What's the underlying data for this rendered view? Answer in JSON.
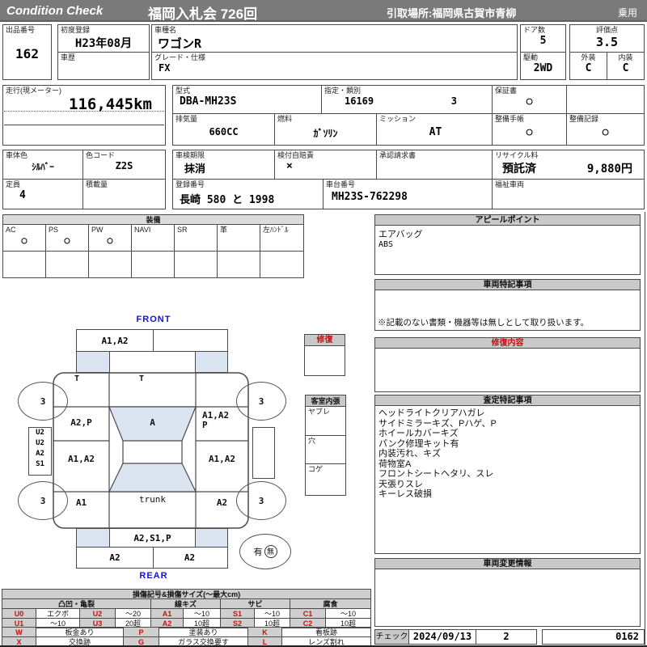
{
  "header": {
    "brand": "Condition  Check",
    "auction": "福岡入札会  726回",
    "pickup": "引取場所:福岡県古賀市青柳",
    "category": "乗用"
  },
  "row1": {
    "lot_label": "出品番号",
    "lot_no": "162",
    "first_reg_label": "初度登録",
    "first_reg": "H23年08月",
    "history_label": "車歴",
    "name_label": "車種名",
    "name": "ワゴンR",
    "grade_label": "グレード・仕様",
    "grade": "FX",
    "doors_label": "ドア数",
    "doors": "5",
    "drive_label": "駆動",
    "drive": "2WD",
    "score_label": "評価点",
    "score": "3.5",
    "ext_label": "外装",
    "ext": "C",
    "int_label": "内装",
    "int": "C"
  },
  "row2": {
    "mileage_label": "走行(現メーター)",
    "mileage": "116,445km",
    "model_label": "型式",
    "model": "DBA-MH23S",
    "desig_label": "指定・類別",
    "desig_no": "16169",
    "class_no": "3",
    "warranty_label": "保証書",
    "warranty": "○",
    "disp_label": "排気量",
    "disp": "660CC",
    "fuel_label": "燃料",
    "fuel": "ｶﾞｿﾘﾝ",
    "trans_label": "ミッション",
    "trans": "AT",
    "book_label": "整備手帳",
    "book": "○",
    "record_label": "整備記録",
    "record": "○"
  },
  "row3": {
    "color_label": "車体色",
    "color": "ｼﾙﾊﾞｰ",
    "ccode_label": "色コード",
    "ccode": "Z2S",
    "insp_label": "車検期限",
    "insp": "抹消",
    "jibai_label": "検付自賠責",
    "jibai": "×",
    "approval_label": "承認請求書",
    "recycle_label": "リサイクル料",
    "recycle_status": "預託済",
    "recycle_fee": "9,880円",
    "cap_label": "定員",
    "cap": "4",
    "load_label": "積載量",
    "reg_label": "登録番号",
    "reg": "長崎  580 と 1998",
    "chassis_label": "車台番号",
    "chassis": "MH23S-762298",
    "welfare_label": "福祉車両"
  },
  "equipment": {
    "title": "装備",
    "items": [
      {
        "label": "AC",
        "value": "○"
      },
      {
        "label": "PS",
        "value": "○"
      },
      {
        "label": "PW",
        "value": "○"
      },
      {
        "label": "NAVI",
        "value": ""
      },
      {
        "label": "SR",
        "value": ""
      },
      {
        "label": "革",
        "value": ""
      },
      {
        "label": "左ﾊﾝﾄﾞﾙ",
        "value": ""
      }
    ]
  },
  "right": {
    "appeal_title": "アピールポイント",
    "appeal_lines": [
      "エアバッグ",
      "ABS"
    ],
    "notes_title": "車両特記事項",
    "notes_text": "※記載のない書類・機器等は無しとして取り扱います。",
    "repair_title": "修復内容",
    "assess_title": "査定特記事項",
    "assess_lines": [
      "ヘッドライトクリアハガレ",
      "サイドミラーキズ、Pハゲ、P",
      "ホイールカバーキズ",
      "パンク修理キット有",
      "内装汚れ、キズ",
      "荷物室A",
      "フロントシートヘタリ、スレ",
      "天張りスレ",
      "キーレス破損"
    ],
    "change_title": "車両変更情報"
  },
  "mid": {
    "repair_title": "修復",
    "cabin_title": "客室内張",
    "cabin_rows": [
      "ヤブレ",
      "穴",
      "コゲ"
    ]
  },
  "diagram": {
    "front_label": "FRONT",
    "rear_label": "REAR",
    "front_bumper": "A1,A2",
    "hood_marks": [
      "T",
      "T"
    ],
    "left_front_door": "A2,P",
    "windshield": "A",
    "right_front_door": [
      "A1,A2",
      "P"
    ],
    "side_codes": [
      "U2",
      "U2",
      "A2",
      "S1"
    ],
    "left_rear_door": "A1,A2",
    "right_rear_door": "A1,A2",
    "left_quarter": "A1",
    "trunk": "trunk",
    "right_quarter": "A2",
    "rear_panel": "A2,S1,P",
    "rear_bumper": [
      "A2",
      "A2"
    ],
    "wheels": [
      "3",
      "3",
      "3",
      "3"
    ],
    "spare_present": "有",
    "spare_absent": "無"
  },
  "legend": {
    "title": "損傷記号&損傷サイズ(〜最大cm)",
    "groups": [
      "凸凹・亀裂",
      "線キズ",
      "サビ",
      "腐食"
    ],
    "row1": [
      "U0",
      "エクボ",
      "U2",
      "〜20",
      "A1",
      "〜10",
      "S1",
      "〜10",
      "C1",
      "〜10"
    ],
    "row2": [
      "U1",
      "〜10",
      "U3",
      "20超",
      "A2",
      "10超",
      "S2",
      "10超",
      "C2",
      "10超"
    ],
    "row3": [
      "W",
      "板金あり",
      "P",
      "塗装あり",
      "K",
      "看板跡"
    ],
    "row4": [
      "X",
      "交換跡",
      "G",
      "ガラス交換要す",
      "L",
      "レンズ割れ"
    ]
  },
  "footer": {
    "check_label": "チェック",
    "date": "2024/09/13",
    "count": "2",
    "serial": "0162"
  }
}
